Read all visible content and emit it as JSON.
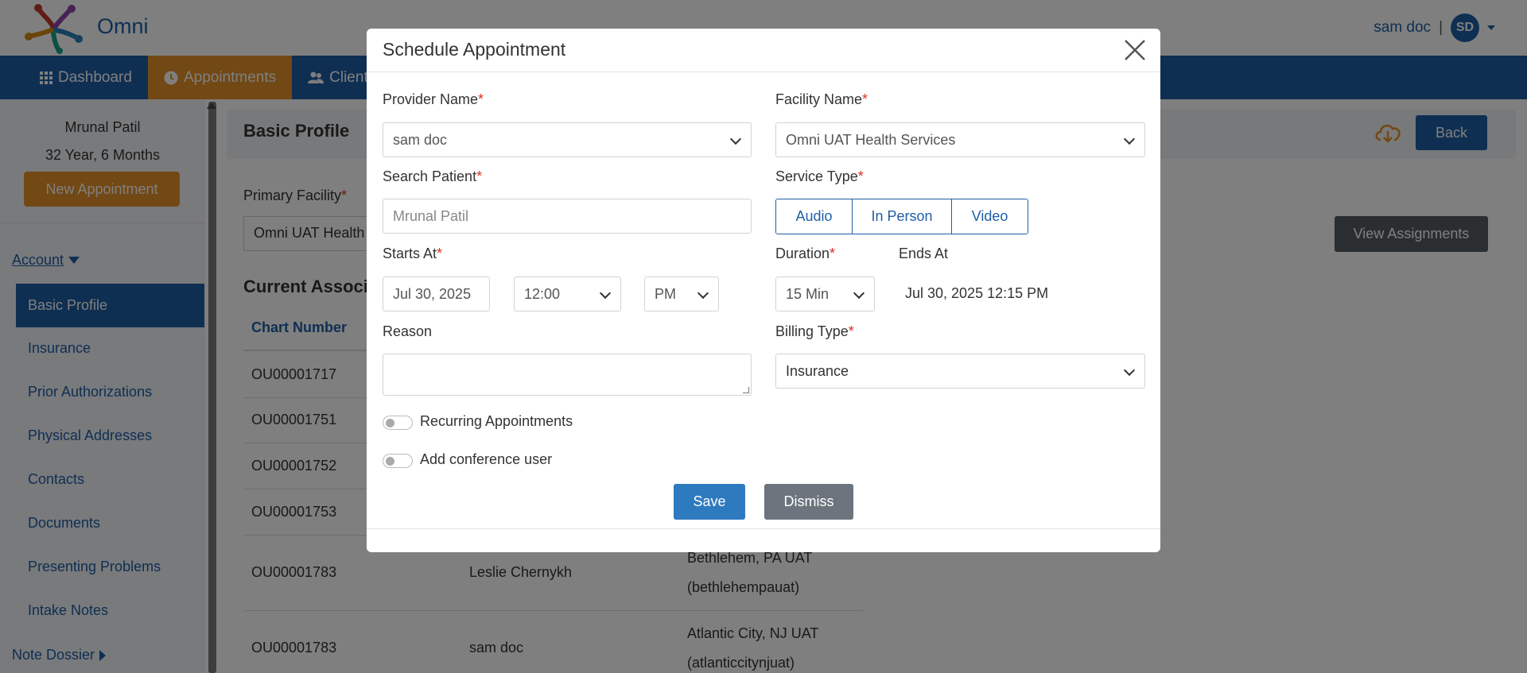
{
  "header": {
    "app_name": "Omni",
    "user_name": "sam doc",
    "separator": "|",
    "user_initials": "SD"
  },
  "nav": {
    "items": [
      {
        "label": "Dashboard",
        "icon": "grid-icon"
      },
      {
        "label": "Appointments",
        "icon": "clock-icon"
      },
      {
        "label": "Clients",
        "icon": "users-icon"
      }
    ]
  },
  "sidebar": {
    "patient_name": "Mrunal Patil",
    "patient_age": "32 Year, 6 Months",
    "new_appointment": "New Appointment",
    "account_label": "Account",
    "items": [
      {
        "label": "Basic Profile"
      },
      {
        "label": "Insurance"
      },
      {
        "label": "Prior Authorizations"
      },
      {
        "label": "Physical Addresses"
      },
      {
        "label": "Contacts"
      },
      {
        "label": "Documents"
      },
      {
        "label": "Presenting Problems"
      },
      {
        "label": "Intake Notes"
      }
    ],
    "note_dossier": "Note Dossier"
  },
  "main": {
    "title": "Basic Profile",
    "back": "Back",
    "primary_facility_label": "Primary Facility",
    "primary_facility_value": "Omni UAT Health S",
    "view_assignments": "View Assignments",
    "current_associations": "Current Associa",
    "table_header": "Chart Number",
    "rows": [
      {
        "chart": "OU00001717",
        "provider": "",
        "facility": "",
        "facility2": ""
      },
      {
        "chart": "OU00001751",
        "provider": "",
        "facility": "",
        "facility2": ""
      },
      {
        "chart": "OU00001752",
        "provider": "",
        "facility": "",
        "facility2": ""
      },
      {
        "chart": "OU00001753",
        "provider": "",
        "facility": "",
        "facility2": ""
      },
      {
        "chart": "OU00001783",
        "provider": "Leslie Chernykh",
        "facility": "Bethlehem, PA UAT",
        "facility2": "(bethlehempauat)"
      },
      {
        "chart": "OU00001783",
        "provider": "sam doc",
        "facility": "Atlantic City, NJ UAT",
        "facility2": "(atlanticcitynjuat)"
      }
    ]
  },
  "modal": {
    "title": "Schedule Appointment",
    "provider_label": "Provider Name",
    "provider_value": "sam doc",
    "facility_label": "Facility Name",
    "facility_value": "Omni UAT Health Services",
    "search_patient_label": "Search Patient",
    "search_patient_placeholder": "Mrunal Patil",
    "service_type_label": "Service Type",
    "service_types": [
      "Audio",
      "In Person",
      "Video"
    ],
    "starts_at_label": "Starts At",
    "start_date": "Jul 30, 2025",
    "start_time": "12:00",
    "start_meridiem": "PM",
    "duration_label": "Duration",
    "duration_value": "15 Min",
    "ends_at_label": "Ends At",
    "ends_at_value": "Jul 30, 2025 12:15 PM",
    "reason_label": "Reason",
    "reason_value": "",
    "billing_type_label": "Billing Type",
    "billing_type_value": "Insurance",
    "recurring_label": "Recurring Appointments",
    "conference_label": "Add conference user",
    "required_mark": "*",
    "save": "Save",
    "dismiss": "Dismiss"
  },
  "colors": {
    "primary": "#1f5fa5",
    "accent": "#e5902a",
    "secondary_button": "#6c757d",
    "required": "#d93025"
  }
}
